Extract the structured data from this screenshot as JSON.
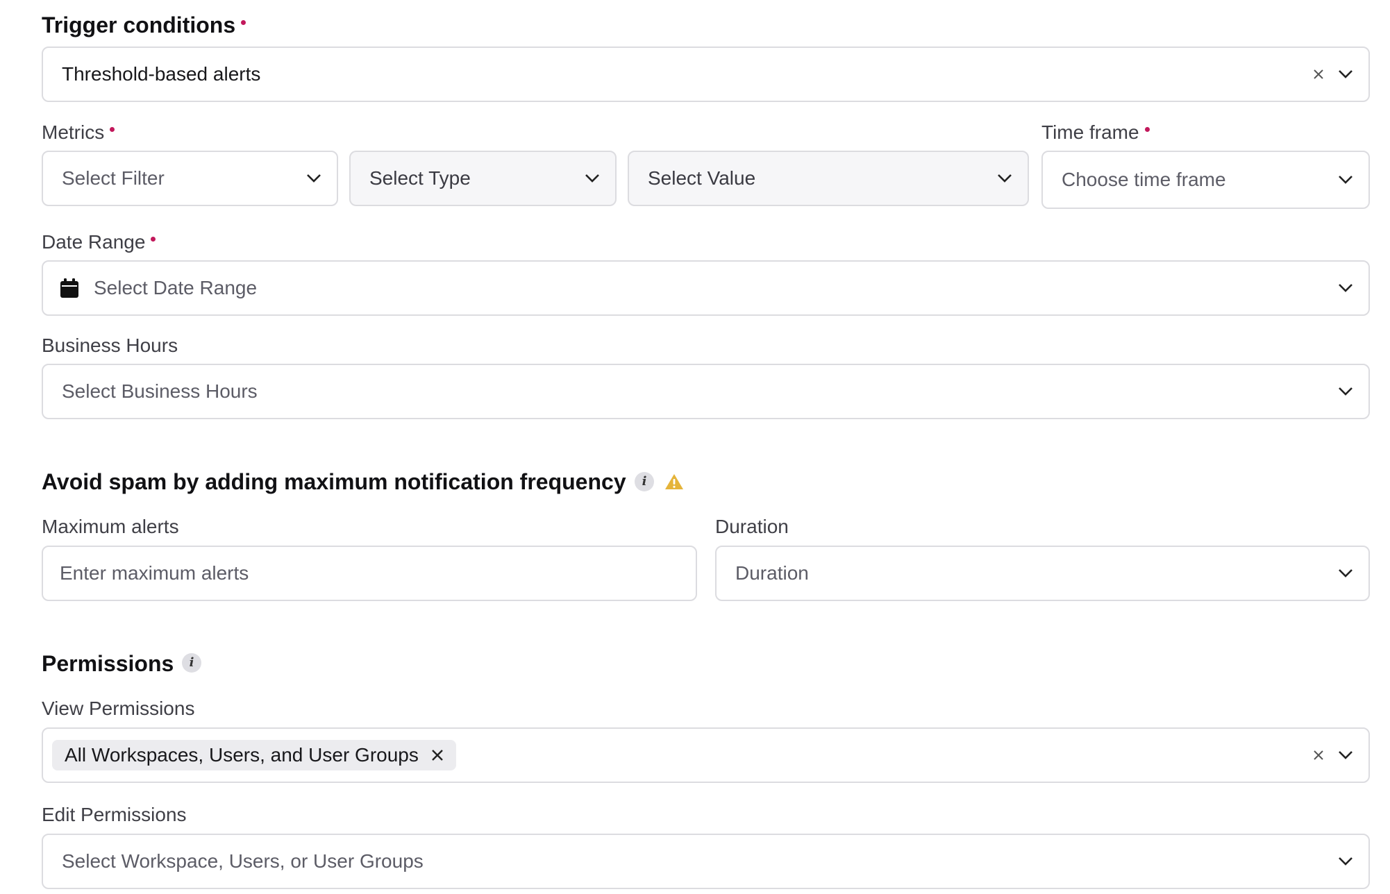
{
  "trigger": {
    "title": "Trigger conditions",
    "selected_value": "Threshold-based alerts"
  },
  "metrics": {
    "label": "Metrics",
    "filter_placeholder": "Select Filter",
    "type_placeholder": "Select Type",
    "value_placeholder": "Select Value"
  },
  "time_frame": {
    "label": "Time frame",
    "placeholder": "Choose time frame"
  },
  "date_range": {
    "label": "Date Range",
    "placeholder": "Select Date Range",
    "icon": "calendar-icon"
  },
  "business_hours": {
    "label": "Business Hours",
    "placeholder": "Select Business Hours"
  },
  "spam": {
    "title": "Avoid spam by adding maximum notification frequency",
    "info_icon": "i",
    "warning_color": "#e5b43a",
    "max_alerts_label": "Maximum alerts",
    "max_alerts_placeholder": "Enter maximum alerts",
    "duration_label": "Duration",
    "duration_placeholder": "Duration"
  },
  "permissions": {
    "title": "Permissions",
    "info_icon": "i",
    "view_label": "View Permissions",
    "view_chip": "All Workspaces, Users, and User Groups",
    "edit_label": "Edit Permissions",
    "edit_placeholder": "Select Workspace, Users, or User Groups"
  },
  "colors": {
    "required_dot": "#c2185b",
    "border": "#dcdce0"
  }
}
